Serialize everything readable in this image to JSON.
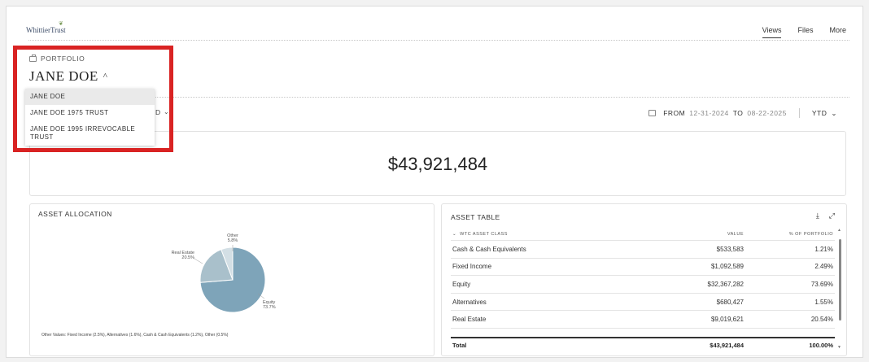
{
  "header": {
    "logo": "WhittierTrust",
    "nav": [
      "Views",
      "Files",
      "More"
    ],
    "active_nav": "Views"
  },
  "portfolio": {
    "label": "PORTFOLIO",
    "selected": "JANE DOE",
    "dropdown_open": true,
    "options": [
      "JANE DOE",
      "JANE DOE 1975 TRUST",
      "JANE DOE 1995 IRREVOCABLE TRUST"
    ]
  },
  "filter": {
    "partial_label": "D",
    "from_label": "FROM",
    "from_date": "12-31-2024",
    "to_label": "TO",
    "to_date": "08-22-2025",
    "period": "YTD"
  },
  "total": {
    "value": "$43,921,484"
  },
  "allocation": {
    "title": "ASSET ALLOCATION",
    "labels": {
      "equity": "Equity",
      "equity_pct": "73.7%",
      "real_estate": "Real Estate",
      "real_estate_pct": "20.5%",
      "other": "Other",
      "other_pct": "5.8%"
    },
    "other_note": "Other Values: Fixed Income (2.5%), Alternatives (1.6%), Cash & Cash Equivalents (1.2%), Other (0.5%)",
    "colors": {
      "equity": "#7ea4b9",
      "real_estate": "#a9c0cb",
      "other": "#d3dfe5"
    }
  },
  "chart_data": {
    "type": "pie",
    "title": "ASSET ALLOCATION",
    "slices": [
      {
        "name": "Equity",
        "value": 73.7
      },
      {
        "name": "Real Estate",
        "value": 20.5
      },
      {
        "name": "Other",
        "value": 5.8
      }
    ],
    "other_breakdown": [
      {
        "name": "Fixed Income",
        "value": 2.5
      },
      {
        "name": "Alternatives",
        "value": 1.6
      },
      {
        "name": "Cash & Cash Equivalents",
        "value": 1.2
      },
      {
        "name": "Other",
        "value": 0.5
      }
    ]
  },
  "table": {
    "title": "ASSET TABLE",
    "columns": [
      "WTC ASSET CLASS",
      "VALUE",
      "% OF PORTFOLIO"
    ],
    "rows": [
      [
        "Cash & Cash Equivalents",
        "$533,583",
        "1.21%"
      ],
      [
        "Fixed Income",
        "$1,092,589",
        "2.49%"
      ],
      [
        "Equity",
        "$32,367,282",
        "73.69%"
      ],
      [
        "Alternatives",
        "$680,427",
        "1.55%"
      ],
      [
        "Real Estate",
        "$9,019,621",
        "20.54%"
      ]
    ],
    "total_row": [
      "Total",
      "$43,921,484",
      "100.00%"
    ]
  }
}
